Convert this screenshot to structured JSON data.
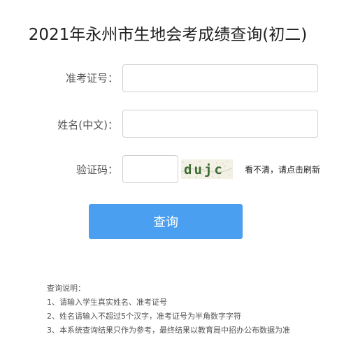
{
  "title": "2021年永州市生地会考成绩查询(初二)",
  "form": {
    "exam_no_label": "准考证号：",
    "exam_no_value": "",
    "name_label": "姓名(中文)：",
    "name_value": "",
    "code_label": "验证码：",
    "code_value": "",
    "captcha_text": "dujc",
    "refresh_text": "看不清，请点击刷新"
  },
  "query_button": "查询",
  "notes": {
    "heading": "查询说明：",
    "items": [
      "1、请输入学生真实姓名、准考证号",
      "2、姓名请输入不超过5个汉字，准考证号为半角数字字符",
      "3、本系统查询结果只作为参考，最终结果以教育局中招办公布数据为准"
    ]
  },
  "colors": {
    "button": "#4a9ff0",
    "captcha_text": "#3d6b33"
  }
}
